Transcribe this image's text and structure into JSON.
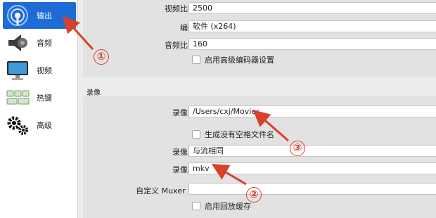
{
  "sidebar": {
    "items": [
      {
        "label": "输出",
        "icon": "broadcast-icon",
        "active": true
      },
      {
        "label": "音频",
        "icon": "speaker-icon",
        "active": false
      },
      {
        "label": "视频",
        "icon": "monitor-icon",
        "active": false
      },
      {
        "label": "热键",
        "icon": "keyboard-icon",
        "active": false
      },
      {
        "label": "高级",
        "icon": "gears-icon",
        "active": false
      }
    ]
  },
  "streaming": {
    "video_bitrate_label": "视频比特率",
    "video_bitrate_value": "2500",
    "encoder_label": "编码器",
    "encoder_value": "软件 (x264)",
    "audio_bitrate_label": "音频比特率",
    "audio_bitrate_value": "160",
    "advanced_encoder_checkbox": "启用高级编码器设置"
  },
  "recording": {
    "section_title": "录像",
    "path_label": "录像路径",
    "path_value": "/Users/cxj/Movies",
    "no_space_checkbox": "生成没有空格文件名",
    "quality_label": "录像质量",
    "quality_value": "与流相同",
    "format_label": "录像格式",
    "format_value": "mkv",
    "muxer_label": "自定义 Muxer 设置",
    "muxer_value": "",
    "replay_buffer_checkbox": "启用回放缓存"
  },
  "annotations": {
    "callout_1": "①",
    "callout_2": "②",
    "callout_3": "③",
    "color": "#d9412b"
  },
  "colors": {
    "accent": "#1f6bd6"
  }
}
